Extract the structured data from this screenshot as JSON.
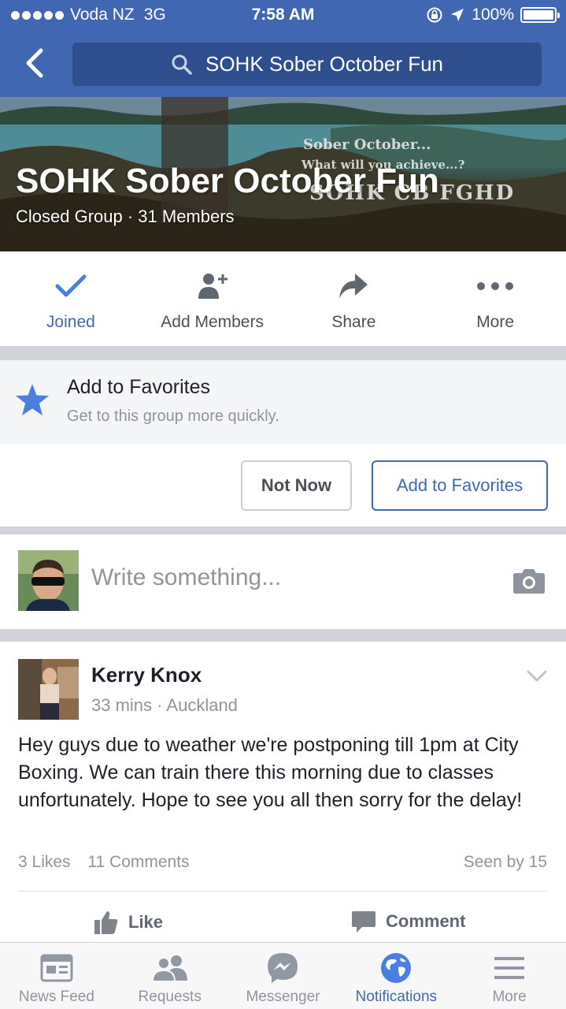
{
  "status_bar": {
    "carrier": "Voda NZ",
    "network": "3G",
    "time": "7:58 AM",
    "battery": "100%",
    "battery_level": 1.0
  },
  "nav": {
    "search_text": "SOHK Sober October Fun"
  },
  "cover": {
    "group_name": "SOHK Sober October Fun",
    "group_info": "Closed Group · 31 Members",
    "image_text_line1": "Sober October...",
    "image_text_line2": "What will you achieve...?",
    "image_text_line3": "SOHK CB FGHD"
  },
  "actions": [
    {
      "label": "Joined",
      "icon": "check-icon"
    },
    {
      "label": "Add Members",
      "icon": "add-person-icon"
    },
    {
      "label": "Share",
      "icon": "share-arrow-icon"
    },
    {
      "label": "More",
      "icon": "more-dots-icon"
    }
  ],
  "favorites_prompt": {
    "title": "Add to Favorites",
    "subtitle": "Get to this group more quickly.",
    "not_now": "Not Now",
    "add": "Add to Favorites"
  },
  "composer": {
    "placeholder": "Write something..."
  },
  "post": {
    "author": "Kerry Knox",
    "time": "33 mins",
    "location": "Auckland",
    "body": "Hey guys due to weather we're postponing till 1pm at City Boxing. We can train there this morning due to classes unfortunately. Hope to see you all then sorry for the delay!",
    "likes": "3 Likes",
    "comments": "11 Comments",
    "seen": "Seen by 15",
    "like_label": "Like",
    "comment_label": "Comment"
  },
  "tabs": [
    {
      "label": "News Feed",
      "icon": "news-feed-icon"
    },
    {
      "label": "Requests",
      "icon": "friend-requests-icon"
    },
    {
      "label": "Messenger",
      "icon": "messenger-icon"
    },
    {
      "label": "Notifications",
      "icon": "globe-icon"
    },
    {
      "label": "More",
      "icon": "hamburger-menu-icon"
    }
  ],
  "colors": {
    "brand_blue": "#4267b2",
    "search_bg": "#2f4e8e",
    "muted_text": "#90949c"
  }
}
